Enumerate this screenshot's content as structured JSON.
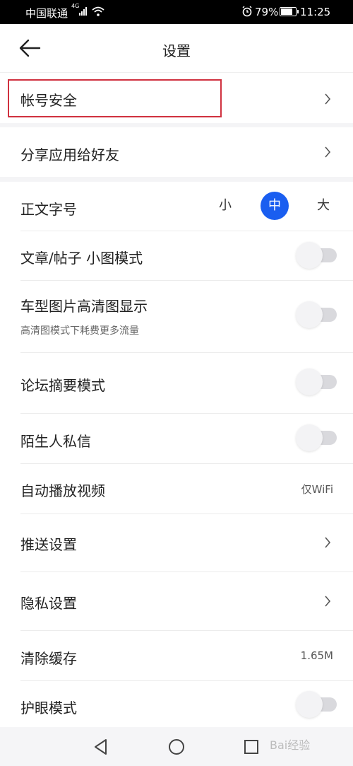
{
  "status_bar": {
    "carrier": "中国联通",
    "network_tag": "4G",
    "battery_text": "79%",
    "battery_level": 0.79,
    "time": "11:25"
  },
  "header": {
    "title": "设置",
    "back_icon": "back-arrow-icon"
  },
  "rows": {
    "account_security": {
      "label": "帐号安全",
      "icon": "chevron-right-icon"
    },
    "share_app": {
      "label": "分享应用给好友",
      "icon": "chevron-right-icon"
    },
    "font_size": {
      "label": "正文字号",
      "options": [
        "小",
        "中",
        "大"
      ],
      "selected": "中"
    },
    "small_image_mode": {
      "label": "文章/帖子 小图模式",
      "enabled": false
    },
    "hd_images": {
      "label": "车型图片高清图显示",
      "sublabel": "高清图模式下耗费更多流量",
      "enabled": false
    },
    "forum_summary": {
      "label": "论坛摘要模式",
      "enabled": false
    },
    "stranger_messages": {
      "label": "陌生人私信",
      "enabled": false
    },
    "autoplay_video": {
      "label": "自动播放视频",
      "value": "仅WiFi"
    },
    "push_settings": {
      "label": "推送设置",
      "icon": "chevron-right-icon"
    },
    "privacy_settings": {
      "label": "隐私设置",
      "icon": "chevron-right-icon"
    },
    "clear_cache": {
      "label": "清除缓存",
      "value": "1.65M"
    },
    "eye_care": {
      "label": "护眼模式",
      "enabled": false
    }
  },
  "nav_bar": {
    "back": "nav-back-icon",
    "home": "nav-home-icon",
    "recents": "nav-recents-icon"
  },
  "watermark": "Bai经验",
  "colors": {
    "accent": "#1a5ef0",
    "highlight_border": "#d0313f",
    "section_gap": "#f4f4f6"
  }
}
